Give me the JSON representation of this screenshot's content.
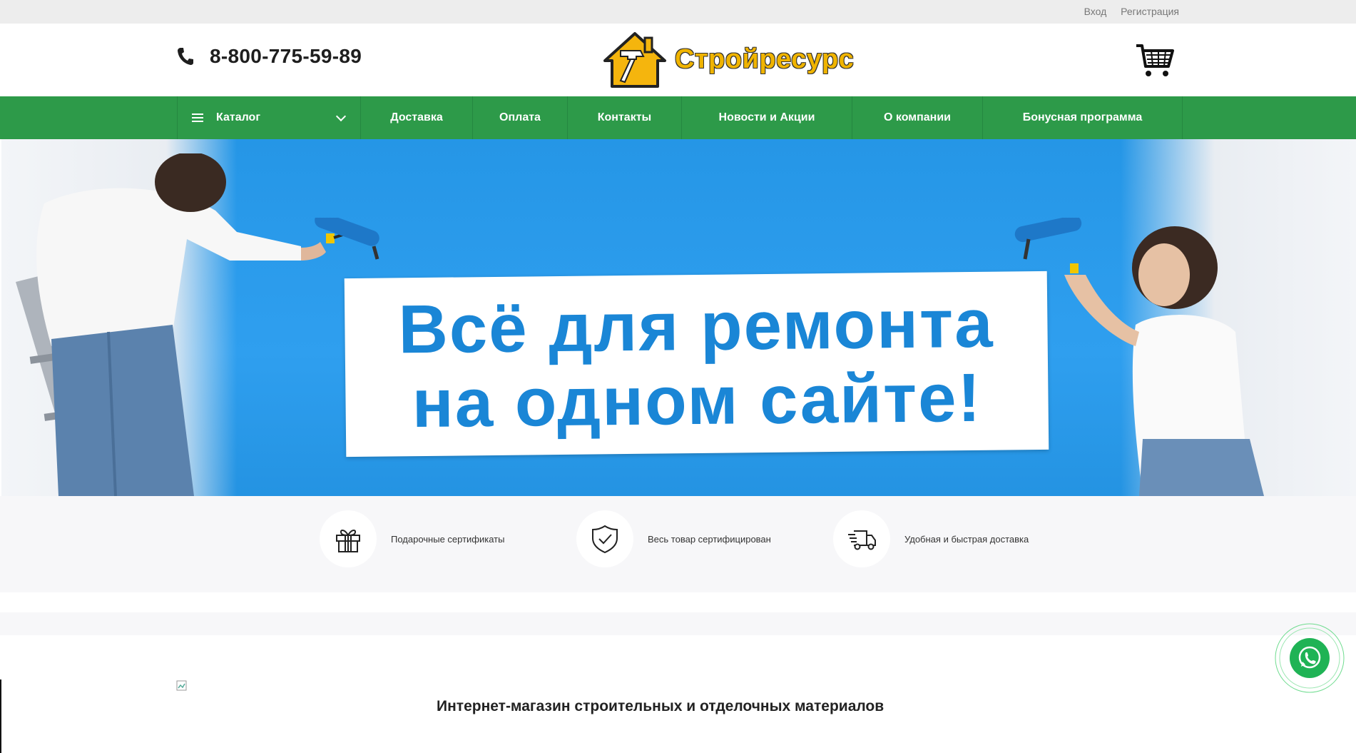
{
  "topbar": {
    "login": "Вход",
    "register": "Регистрация"
  },
  "header": {
    "phone": "8-800-775-59-89",
    "brand": "Стройресурс"
  },
  "nav": {
    "catalog": "Каталог",
    "items": [
      {
        "label": "Доставка"
      },
      {
        "label": "Оплата"
      },
      {
        "label": "Контакты"
      },
      {
        "label": "Новости и Акции"
      },
      {
        "label": "О компании"
      },
      {
        "label": "Бонусная программа"
      }
    ]
  },
  "banner": {
    "line1": "Всё для ремонта",
    "line2": "на одном сайте!"
  },
  "features": [
    {
      "icon": "gift-icon",
      "label": "Подарочные сертификаты"
    },
    {
      "icon": "shield-check-icon",
      "label": "Весь товар сертифицирован"
    },
    {
      "icon": "delivery-truck-icon",
      "label": "Удобная и быстрая доставка"
    }
  ],
  "content": {
    "title": "Интернет-магазин строительных и отделочных материалов"
  },
  "colors": {
    "nav_green": "#2d9a49",
    "brand_yellow": "#f0b400",
    "banner_blue": "#2596e6",
    "whatsapp": "#25d366"
  }
}
